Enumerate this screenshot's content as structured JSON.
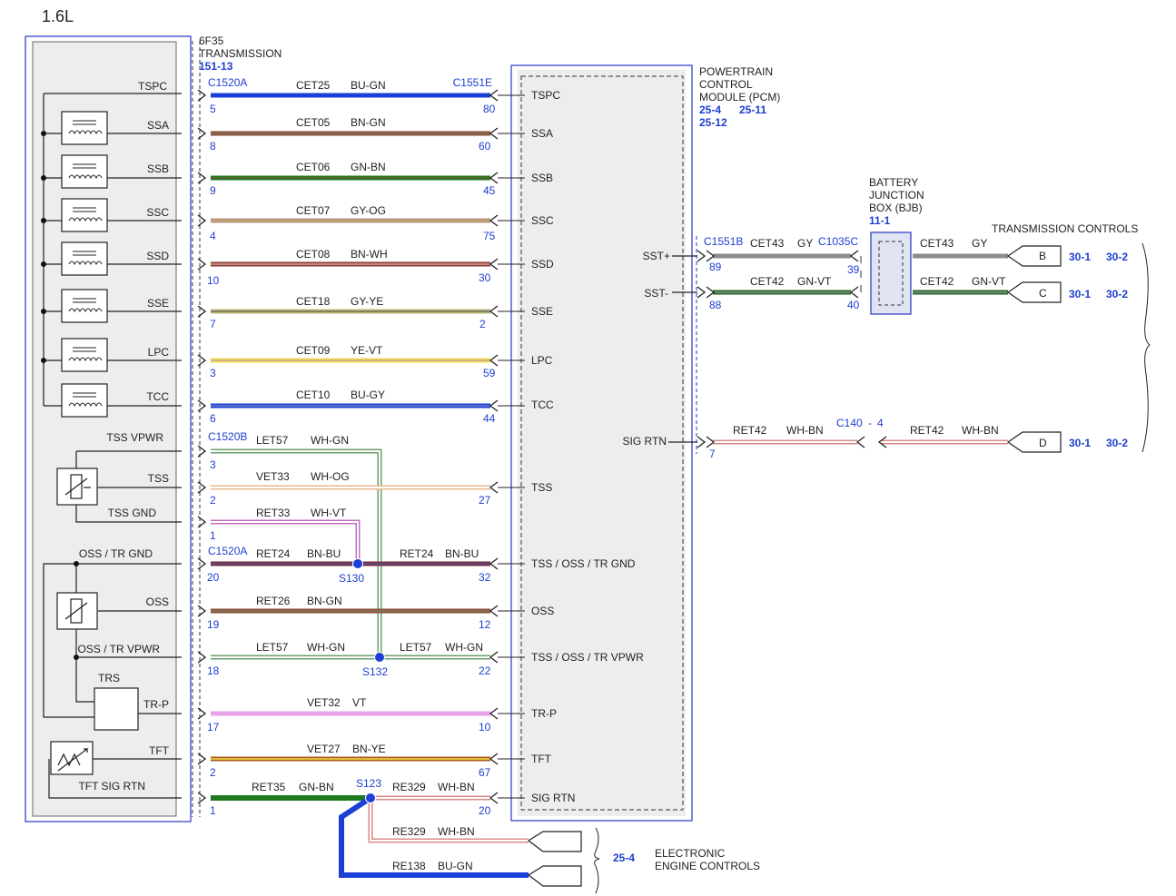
{
  "title": "1.6L",
  "colors": {
    "BU-GN": "#1c3fd8",
    "BN-GN": "#8a4a3a",
    "GN-BN": "#1f7a1f",
    "GY-OG": "#b09a80",
    "BN-WH": "#8a3a30",
    "GY-YE": "#bdbb7a",
    "YE-VT": "#f2dc4a",
    "BU-GY": "#1c3fd8",
    "WH-GN": "#dcefdc",
    "WH-OG": "#f6e2c8",
    "WH-VT": "#f1d6f1",
    "BN-BU": "#743040",
    "VT": "#e8a3e8",
    "BN-YE": "#a85a1a",
    "WH-BN": "#f0dede",
    "GY": "#8c8c8c",
    "GN-VT": "#1f6a1f",
    "accent": "#1d3fd0"
  },
  "transmission": {
    "name_line1": "6F35",
    "name_line2": "TRANSMISSION",
    "ref": "151-13",
    "signals": [
      "TSPC",
      "SSA",
      "SSB",
      "SSC",
      "SSD",
      "SSE",
      "LPC",
      "TCC",
      "TSS VPWR",
      "TSS",
      "TSS GND",
      "OSS / TR GND",
      "OSS",
      "OSS / TR VPWR",
      "TR-P",
      "TFT",
      "TFT SIG RTN"
    ],
    "component_trs": "TRS"
  },
  "pcm": {
    "name_line1": "POWERTRAIN",
    "name_line2": "CONTROL",
    "name_line3": "MODULE (PCM)",
    "refs": [
      "25-4",
      "25-11",
      "25-12"
    ],
    "pins": [
      "TSPC",
      "SSA",
      "SSB",
      "SSC",
      "SSD",
      "SSE",
      "LPC",
      "TCC",
      "TSS",
      "TSS / OSS / TR GND",
      "OSS",
      "TSS / OSS / TR VPWR",
      "TR-P",
      "TFT",
      "SIG RTN",
      "SST+",
      "SST-",
      "SIG RTN"
    ]
  },
  "connectors": {
    "c1520a": "C1520A",
    "c1520b": "C1520B",
    "c1551e": "C1551E",
    "c1551b": "C1551B",
    "c1035c": "C1035C",
    "c140": "C140",
    "c140_pin": "4"
  },
  "wires": [
    {
      "circuit": "CET25",
      "color": "BU-GN",
      "tp": "5",
      "pp": "80"
    },
    {
      "circuit": "CET05",
      "color": "BN-GN",
      "tp": "8",
      "pp": "60"
    },
    {
      "circuit": "CET06",
      "color": "GN-BN",
      "tp": "9",
      "pp": "45"
    },
    {
      "circuit": "CET07",
      "color": "GY-OG",
      "tp": "4",
      "pp": "75"
    },
    {
      "circuit": "CET08",
      "color": "BN-WH",
      "tp": "10",
      "pp": "30"
    },
    {
      "circuit": "CET18",
      "color": "GY-YE",
      "tp": "7",
      "pp": "2"
    },
    {
      "circuit": "CET09",
      "color": "YE-VT",
      "tp": "3",
      "pp": "59"
    },
    {
      "circuit": "CET10",
      "color": "BU-GY",
      "tp": "6",
      "pp": "44"
    },
    {
      "circuit": "LET57",
      "color": "WH-GN",
      "tp": "3",
      "pp": ""
    },
    {
      "circuit": "VET33",
      "color": "WH-OG",
      "tp": "2",
      "pp": "27"
    },
    {
      "circuit": "RET33",
      "color": "WH-VT",
      "tp": "1",
      "pp": ""
    },
    {
      "circuit": "RET24",
      "color": "BN-BU",
      "tp": "20",
      "pp": "32"
    },
    {
      "circuit": "RET26",
      "color": "BN-GN",
      "tp": "19",
      "pp": "12"
    },
    {
      "circuit": "LET57",
      "color": "WH-GN",
      "tp": "18",
      "pp": "22"
    },
    {
      "circuit": "VET32",
      "color": "VT",
      "tp": "17",
      "pp": "10"
    },
    {
      "circuit": "VET27",
      "color": "BN-YE",
      "tp": "2",
      "pp": "67"
    },
    {
      "circuit": "RET35",
      "color": "GN-BN",
      "tp": "1",
      "pp": ""
    },
    {
      "circuit": "RE329",
      "color": "WH-BN",
      "tp": "",
      "pp": "20"
    }
  ],
  "splices": {
    "s130": "S130",
    "s132": "S132",
    "s123": "S123"
  },
  "right_wires": [
    {
      "circuit": "CET43",
      "color": "GY",
      "pcm_pin": "89",
      "bjb_pin": "39",
      "letter": "B"
    },
    {
      "circuit": "CET42",
      "color": "GN-VT",
      "pcm_pin": "88",
      "bjb_pin": "40",
      "letter": "C"
    },
    {
      "circuit": "RET42",
      "color": "WH-BN",
      "pcm_pin": "7",
      "letter": "D"
    }
  ],
  "bjb": {
    "line1": "BATTERY",
    "line2": "JUNCTION",
    "line3": "BOX (BJB)",
    "ref": "11-1"
  },
  "transmission_controls": {
    "label": "TRANSMISSION CONTROLS",
    "refs": [
      "30-1",
      "30-2"
    ]
  },
  "engine_controls": {
    "ref": "25-4",
    "line1": "ELECTRONIC",
    "line2": "ENGINE CONTROLS",
    "wires": [
      {
        "circuit": "RE329",
        "color": "WH-BN"
      },
      {
        "circuit": "RE138",
        "color": "BU-GN"
      }
    ]
  }
}
